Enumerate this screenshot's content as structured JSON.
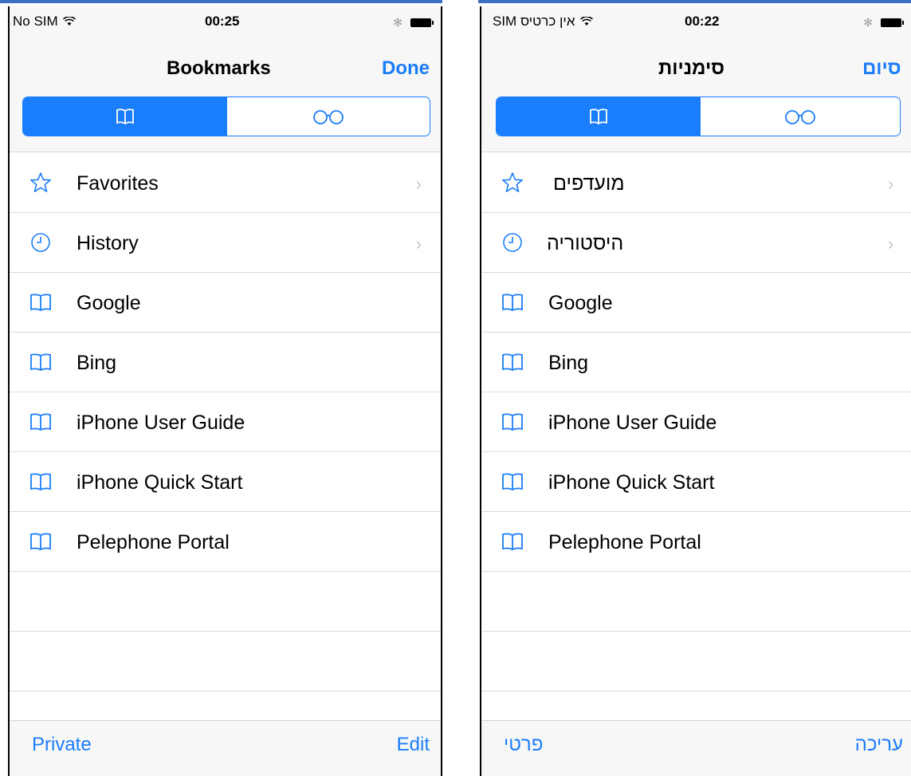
{
  "left": {
    "status": {
      "carrier": "No SIM",
      "time": "00:25"
    },
    "nav": {
      "title": "Bookmarks",
      "done": "Done"
    },
    "items": [
      {
        "label": "Favorites",
        "icon": "star-icon"
      },
      {
        "label": "History",
        "icon": "clock-icon"
      },
      {
        "label": "Google",
        "icon": "book-icon"
      },
      {
        "label": "Bing",
        "icon": "book-icon"
      },
      {
        "label": "iPhone User Guide",
        "icon": "book-icon"
      },
      {
        "label": "iPhone Quick Start",
        "icon": "book-icon"
      },
      {
        "label": "Pelephone Portal",
        "icon": "book-icon"
      }
    ],
    "bottom": {
      "left": "Private",
      "right": "Edit"
    }
  },
  "right": {
    "status": {
      "carrier": "אין כרטיס SIM",
      "time": "00:22"
    },
    "nav": {
      "title": "סימניות",
      "done": "סיום"
    },
    "items": [
      {
        "label": "מועדפים",
        "icon": "star-icon"
      },
      {
        "label": "היסטוריה",
        "icon": "clock-icon"
      },
      {
        "label": "Google",
        "icon": "book-icon"
      },
      {
        "label": "Bing",
        "icon": "book-icon"
      },
      {
        "label": "iPhone User Guide",
        "icon": "book-icon"
      },
      {
        "label": "iPhone Quick Start",
        "icon": "book-icon"
      },
      {
        "label": "Pelephone Portal",
        "icon": "book-icon"
      }
    ],
    "bottom": {
      "left": "פרטי",
      "right": "עריכה"
    }
  },
  "colors": {
    "accent": "#1a7dfb",
    "separator": "#dcdcde",
    "bar_bg": "#f7f7f7",
    "chevron": "#c7c7cc"
  }
}
